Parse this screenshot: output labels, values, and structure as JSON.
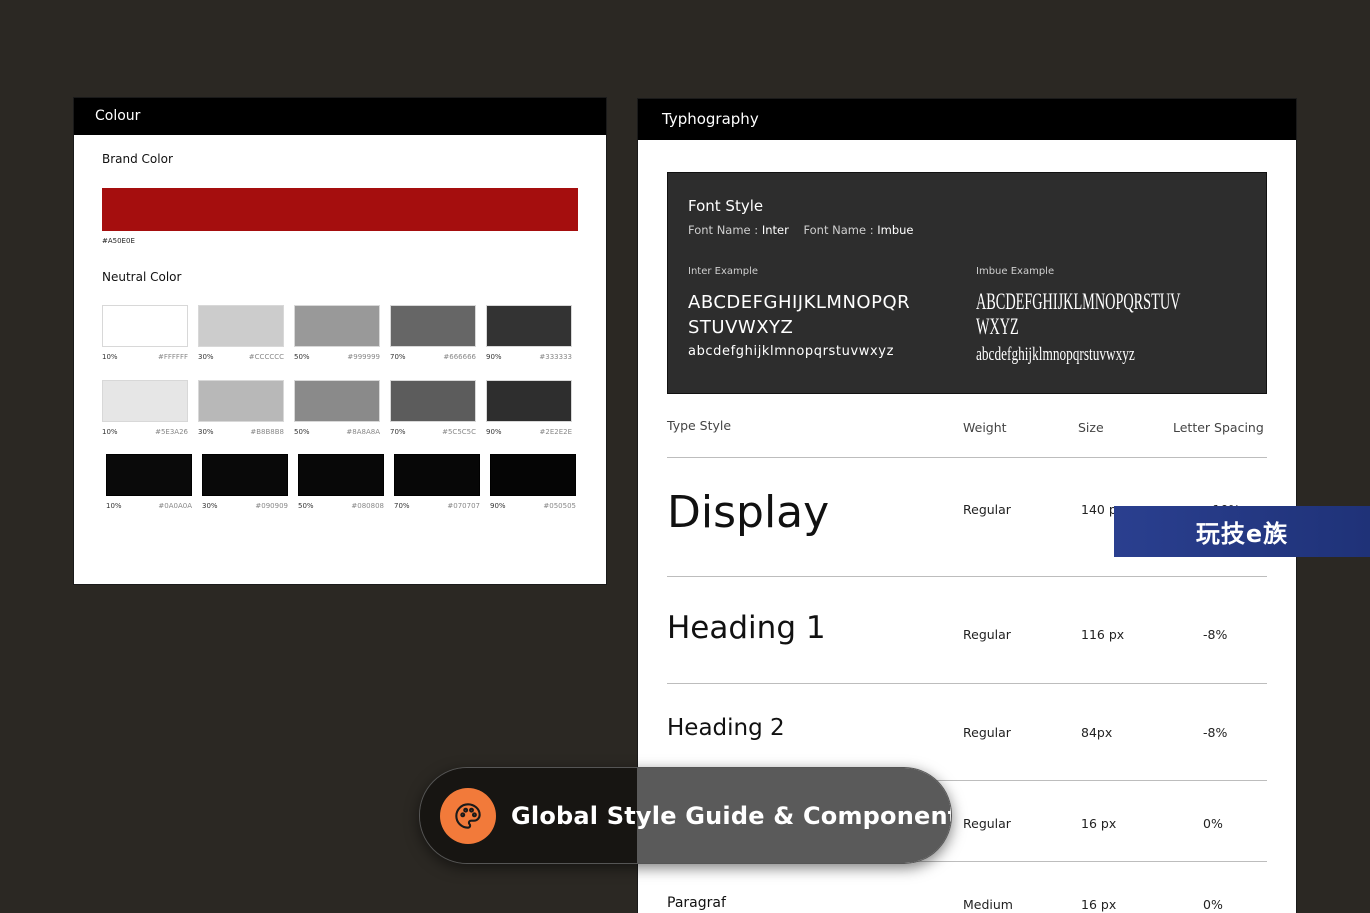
{
  "colour": {
    "title": "Colour",
    "brand_label": "Brand Color",
    "brand_color": "#A50E0E",
    "brand_hex": "#A50E0E",
    "neutral_label": "Neutral Color",
    "rows": [
      [
        {
          "pct": "10%",
          "hex": "#FFFFFF",
          "color": "#FFFFFF"
        },
        {
          "pct": "30%",
          "hex": "#CCCCCC",
          "color": "#CCCCCC"
        },
        {
          "pct": "50%",
          "hex": "#999999",
          "color": "#999999"
        },
        {
          "pct": "70%",
          "hex": "#666666",
          "color": "#666666"
        },
        {
          "pct": "90%",
          "hex": "#333333",
          "color": "#333333"
        }
      ],
      [
        {
          "pct": "10%",
          "hex": "#5E3A26",
          "color": "#E6E6E6"
        },
        {
          "pct": "30%",
          "hex": "#B8B8B8",
          "color": "#B8B8B8"
        },
        {
          "pct": "50%",
          "hex": "#8A8A8A",
          "color": "#8A8A8A"
        },
        {
          "pct": "70%",
          "hex": "#5C5C5C",
          "color": "#5C5C5C"
        },
        {
          "pct": "90%",
          "hex": "#2E2E2E",
          "color": "#2E2E2E"
        }
      ],
      [
        {
          "pct": "10%",
          "hex": "#0A0A0A",
          "color": "#0A0A0A"
        },
        {
          "pct": "30%",
          "hex": "#090909",
          "color": "#090909"
        },
        {
          "pct": "50%",
          "hex": "#080808",
          "color": "#080808"
        },
        {
          "pct": "70%",
          "hex": "#070707",
          "color": "#070707"
        },
        {
          "pct": "90%",
          "hex": "#050505",
          "color": "#050505"
        }
      ]
    ]
  },
  "typography": {
    "title": "Typhography",
    "font_style_title": "Font Style",
    "font_name_label_1": "Font Name : ",
    "font_name_1": "Inter",
    "font_name_label_2": "Font Name : ",
    "font_name_2": "Imbue",
    "inter_label": "Inter Example",
    "inter_upper": "ABCDEFGHIJKLMNOPQR STUVWXYZ",
    "inter_lower": "abcdefghijklmnopqrstuvwxyz",
    "imbue_label": "Imbue Example",
    "imbue_upper": "ABCDEFGHIJKLMNOPQRSTUV WXYZ",
    "imbue_lower": "abcdefghijklmnopqrstuvwxyz",
    "headers": {
      "type_style": "Type Style",
      "weight": "Weight",
      "size": "Size",
      "letter_spacing": "Letter Spacing"
    },
    "rows": [
      {
        "name": "Display",
        "weight": "Regular",
        "size": "140 px",
        "spacing": "-10%"
      },
      {
        "name": "Heading 1",
        "weight": "Regular",
        "size": "116 px",
        "spacing": "-8%"
      },
      {
        "name": "Heading 2",
        "weight": "Regular",
        "size": "84px",
        "spacing": "-8%"
      },
      {
        "name": "",
        "weight": "Regular",
        "size": "16 px",
        "spacing": "0%"
      },
      {
        "name": "Paragraf",
        "weight": "Medium",
        "size": "16 px",
        "spacing": "0%"
      }
    ]
  },
  "watermark": {
    "text": "玩技e族"
  },
  "banner": {
    "text": "Global Style Guide & Component",
    "icon": "palette-icon",
    "accent": "#F27A3A"
  }
}
